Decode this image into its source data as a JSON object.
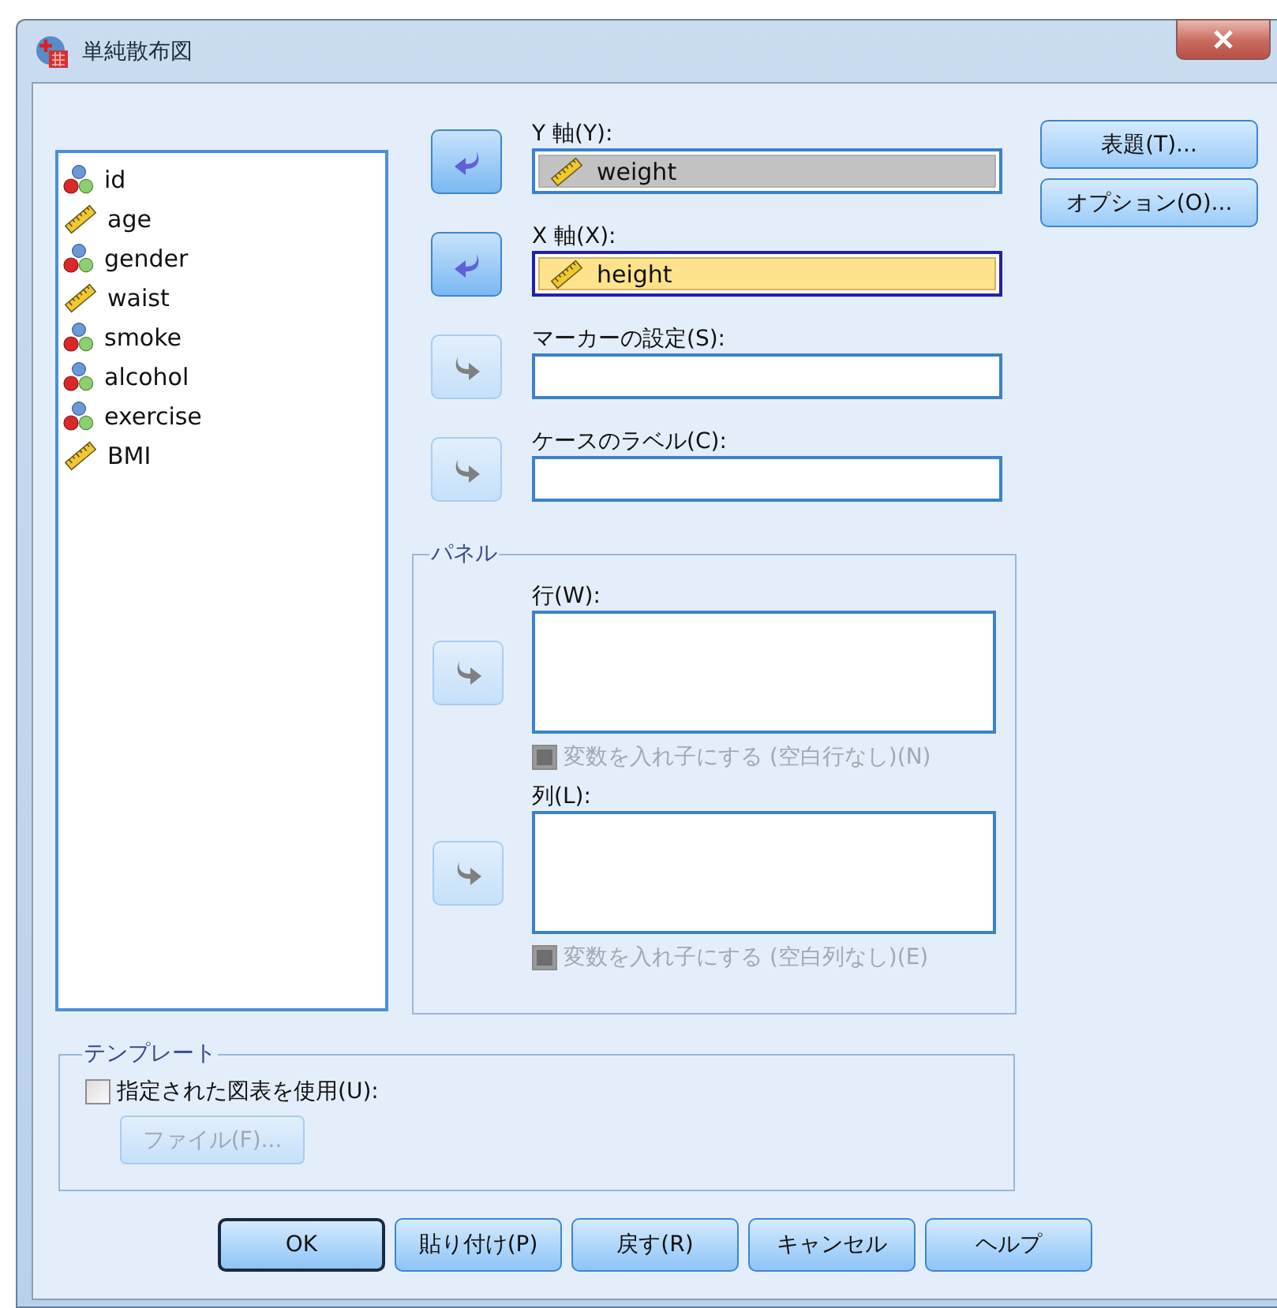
{
  "window": {
    "title": "単純散布図"
  },
  "variables": [
    {
      "name": "id",
      "kind": "nominal"
    },
    {
      "name": "age",
      "kind": "scale"
    },
    {
      "name": "gender",
      "kind": "nominal"
    },
    {
      "name": "waist",
      "kind": "scale"
    },
    {
      "name": "smoke",
      "kind": "nominal"
    },
    {
      "name": "alcohol",
      "kind": "nominal"
    },
    {
      "name": "exercise",
      "kind": "nominal"
    },
    {
      "name": "BMI",
      "kind": "scale"
    }
  ],
  "targets": [
    {
      "label": "Y 軸(Y):",
      "value": {
        "name": "weight",
        "kind": "scale"
      },
      "focused": false,
      "arrow": {
        "kind": "left",
        "disabled": false
      }
    },
    {
      "label": "X 軸(X):",
      "value": {
        "name": "height",
        "kind": "scale"
      },
      "focused": true,
      "arrow": {
        "kind": "left",
        "disabled": false
      }
    },
    {
      "label": "マーカーの設定(S):",
      "focused": false,
      "arrow": {
        "kind": "right",
        "disabled": true
      }
    },
    {
      "label": "ケースのラベル(C):",
      "focused": false,
      "arrow": {
        "kind": "right",
        "disabled": true
      }
    }
  ],
  "panel": {
    "title": "パネル",
    "fields": [
      {
        "label": "行(W):",
        "arrow": {
          "kind": "right",
          "disabled": true
        },
        "nest": {
          "label": "変数を入れ子にする (空白行なし)(N)",
          "checked": false,
          "disabled": true
        }
      },
      {
        "label": "列(L):",
        "arrow": {
          "kind": "right",
          "disabled": true
        },
        "nest": {
          "label": "変数を入れ子にする (空白列なし)(E)",
          "checked": false,
          "disabled": true
        }
      }
    ]
  },
  "side_buttons": [
    "表題(T)...",
    "オプション(O)..."
  ],
  "template": {
    "title": "テンプレート",
    "checkbox": {
      "label": "指定された図表を使用(U):",
      "checked": false,
      "disabled": false
    },
    "file_button": {
      "label": "ファイル(F)...",
      "disabled": true
    }
  },
  "buttons": [
    {
      "label": "OK",
      "default": true
    },
    {
      "label": "貼り付け(P)",
      "default": false
    },
    {
      "label": "戻す(R)",
      "default": false
    },
    {
      "label": "キャンセル",
      "default": false
    },
    {
      "label": "ヘルプ",
      "default": false
    }
  ]
}
